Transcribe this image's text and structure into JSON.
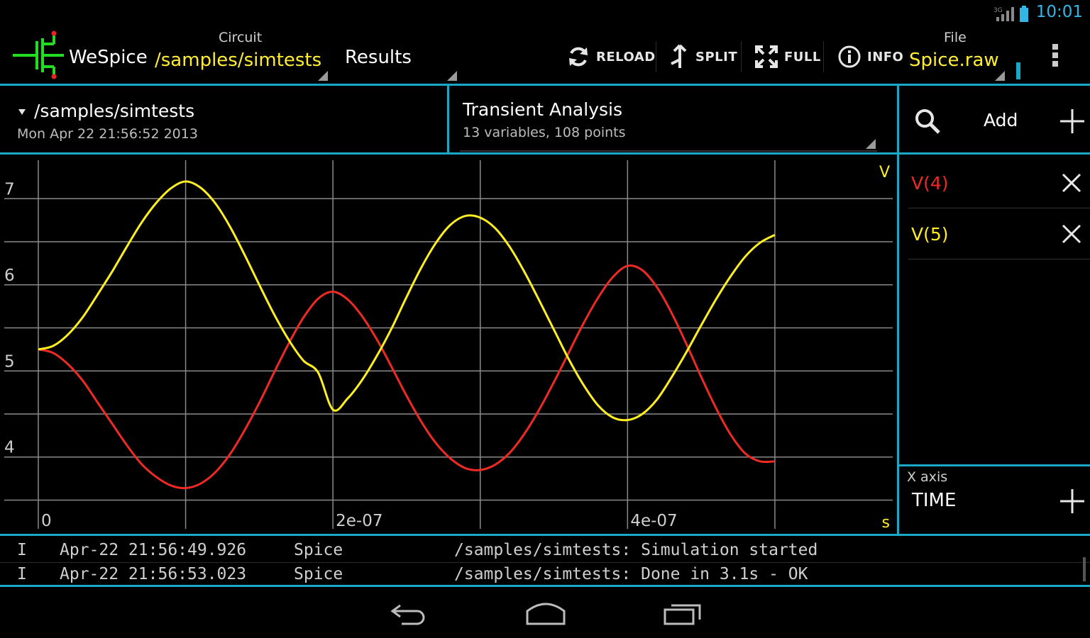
{
  "status_bar": {
    "time": "10:01",
    "signal_label": "3G"
  },
  "action_bar": {
    "app_name": "WeSpice",
    "circuit_label": "Circuit",
    "circuit_value": "/samples/simtests",
    "results_label": "Results",
    "reload_label": "RELOAD",
    "split_label": "SPLIT",
    "full_label": "FULL",
    "info_label": "INFO",
    "file_label": "File",
    "file_value": "Spice.raw"
  },
  "info_row": {
    "path": "/samples/simtests",
    "date": "Mon Apr 22 21:56:52  2013",
    "analysis_title": "Transient Analysis",
    "analysis_sub": "13 variables,  108 points"
  },
  "side_panel": {
    "add_label": "Add",
    "variables": [
      {
        "label": "V(4)",
        "color": "#ee2a24"
      },
      {
        "label": "V(5)",
        "color": "#ffee22"
      }
    ],
    "x_axis_label": "X axis",
    "x_axis_value": "TIME"
  },
  "chart_data": {
    "type": "line",
    "x_unit": "s",
    "y_unit": "V",
    "xlim": [
      -2.6e-08,
      5.8e-07
    ],
    "ylim": [
      3.15,
      7.48
    ],
    "x_ticks": [
      0,
      2e-07,
      4e-07
    ],
    "x_tick_labels": [
      "0",
      "2e-07",
      "4e-07"
    ],
    "y_ticks": [
      4,
      5,
      6,
      7
    ],
    "y_tick_labels": [
      "4",
      "5",
      "6",
      "7"
    ],
    "grid": true,
    "series": [
      {
        "name": "V(4)",
        "color": "#ee2a24",
        "x": [
          0,
          1e-08,
          2e-08,
          3e-08,
          4e-08,
          5e-08,
          6e-08,
          7e-08,
          8e-08,
          9e-08,
          1e-07,
          1.1e-07,
          1.2e-07,
          1.3e-07,
          1.4e-07,
          1.5e-07,
          1.6e-07,
          1.7e-07,
          1.8e-07,
          1.9e-07,
          2e-07,
          2.1e-07,
          2.2e-07,
          2.3e-07,
          2.4e-07,
          2.5e-07,
          2.6e-07,
          2.7e-07,
          2.8e-07,
          2.9e-07,
          3e-07,
          3.1e-07,
          3.2e-07,
          3.3e-07,
          3.4e-07,
          3.5e-07,
          3.6e-07,
          3.7e-07,
          3.8e-07,
          3.9e-07,
          4e-07,
          4.1e-07,
          4.2e-07,
          4.3e-07,
          4.4e-07,
          4.5e-07,
          4.6e-07,
          4.7e-07,
          4.8e-07,
          4.9e-07,
          5e-07
        ],
        "y": [
          5.25,
          5.21,
          5.08,
          4.89,
          4.64,
          4.39,
          4.14,
          3.92,
          3.77,
          3.67,
          3.64,
          3.69,
          3.82,
          4.03,
          4.31,
          4.63,
          4.98,
          5.32,
          5.62,
          5.84,
          5.92,
          5.83,
          5.63,
          5.36,
          5.04,
          4.71,
          4.41,
          4.16,
          3.98,
          3.87,
          3.85,
          3.91,
          4.05,
          4.27,
          4.55,
          4.87,
          5.21,
          5.55,
          5.85,
          6.09,
          6.22,
          6.17,
          5.97,
          5.67,
          5.31,
          4.93,
          4.57,
          4.26,
          4.04,
          3.95,
          3.95
        ]
      },
      {
        "name": "V(5)",
        "color": "#ffee22",
        "x": [
          0,
          1e-08,
          2e-08,
          3e-08,
          4e-08,
          5e-08,
          6e-08,
          7e-08,
          8e-08,
          9e-08,
          1e-07,
          1.1e-07,
          1.2e-07,
          1.3e-07,
          1.4e-07,
          1.5e-07,
          1.6e-07,
          1.7e-07,
          1.8e-07,
          1.9e-07,
          2e-07,
          2.1e-07,
          2.2e-07,
          2.3e-07,
          2.4e-07,
          2.5e-07,
          2.6e-07,
          2.7e-07,
          2.8e-07,
          2.9e-07,
          3e-07,
          3.1e-07,
          3.2e-07,
          3.3e-07,
          3.4e-07,
          3.5e-07,
          3.6e-07,
          3.7e-07,
          3.8e-07,
          3.9e-07,
          4e-07,
          4.1e-07,
          4.2e-07,
          4.3e-07,
          4.4e-07,
          4.5e-07,
          4.6e-07,
          4.7e-07,
          4.8e-07,
          4.9e-07,
          5e-07
        ],
        "y": [
          5.25,
          5.29,
          5.42,
          5.62,
          5.88,
          6.15,
          6.44,
          6.72,
          6.95,
          7.12,
          7.2,
          7.13,
          6.95,
          6.68,
          6.35,
          6.0,
          5.66,
          5.36,
          5.12,
          4.98,
          4.55,
          4.68,
          4.9,
          5.18,
          5.5,
          5.86,
          6.2,
          6.49,
          6.7,
          6.8,
          6.78,
          6.66,
          6.44,
          6.15,
          5.82,
          5.48,
          5.14,
          4.84,
          4.6,
          4.46,
          4.43,
          4.5,
          4.67,
          4.93,
          5.22,
          5.53,
          5.83,
          6.1,
          6.33,
          6.49,
          6.58
        ]
      }
    ]
  },
  "log": [
    {
      "level": "I",
      "time": "Apr-22 21:56:49.926",
      "tag": "Spice",
      "message": "/samples/simtests: Simulation started"
    },
    {
      "level": "I",
      "time": "Apr-22 21:56:53.023",
      "tag": "Spice",
      "message": "/samples/simtests: Done in 3.1s - OK"
    }
  ]
}
